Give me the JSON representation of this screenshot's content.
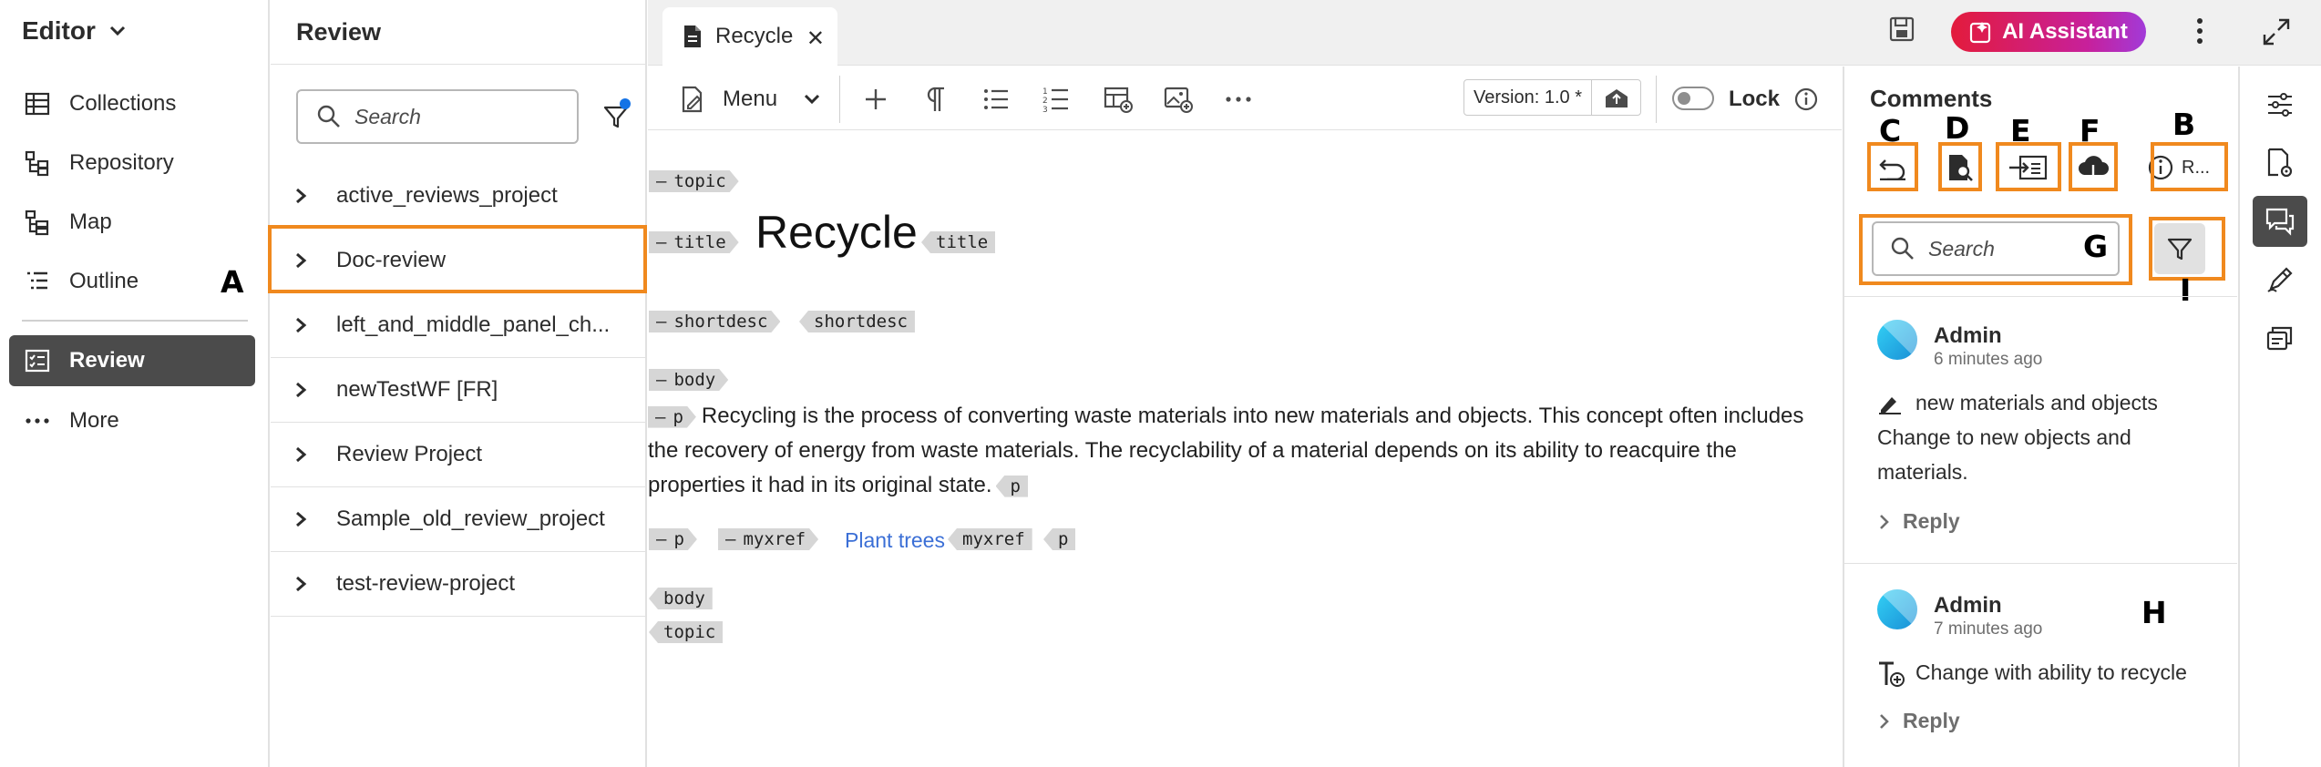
{
  "left_nav": {
    "title": "Editor",
    "items": [
      {
        "label": "Collections",
        "icon": "collections-icon"
      },
      {
        "label": "Repository",
        "icon": "repository-icon"
      },
      {
        "label": "Map",
        "icon": "map-icon"
      },
      {
        "label": "Outline",
        "icon": "outline-icon"
      },
      {
        "label": "Review",
        "icon": "review-icon",
        "active": true
      },
      {
        "label": "More",
        "icon": "more-dots-icon"
      }
    ],
    "callout": "A"
  },
  "review_panel": {
    "title": "Review",
    "search_placeholder": "Search",
    "projects": [
      "active_reviews_project",
      "Doc-review",
      "left_and_middle_panel_ch...",
      "newTestWF [FR]",
      "Review Project",
      "Sample_old_review_project",
      "test-review-project"
    ]
  },
  "tabs": [
    {
      "label": "Recycle",
      "icon": "document-icon"
    }
  ],
  "header": {
    "ai_assistant_label": "AI Assistant"
  },
  "toolbar": {
    "menu_label": "Menu",
    "version_label": "Version: 1.0 *",
    "lock_label": "Lock"
  },
  "document": {
    "tags": {
      "topic": "topic",
      "title": "title",
      "shortdesc": "shortdesc",
      "body": "body",
      "p": "p",
      "myxref": "myxref"
    },
    "title_text": "Recycle",
    "paragraph": "Recycling is the process of converting waste materials into new materials and objects. This concept often includes the recovery of energy from waste materials. The recyclability of a material depends on its ability to reacquire the properties it had in its original state.",
    "link_text": "Plant trees"
  },
  "comments_panel": {
    "title": "Comments",
    "search_placeholder": "Search",
    "info_label": "R...",
    "callouts": {
      "B": "B",
      "C": "C",
      "D": "D",
      "E": "E",
      "F": "F",
      "G": "G",
      "H": "H",
      "I": "I"
    },
    "comments": [
      {
        "user": "Admin",
        "time": "6 minutes ago",
        "icon": "highlight-pen-icon",
        "quote": "new materials and objects",
        "text": "Change to new objects and materials.",
        "reply_label": "Reply"
      },
      {
        "user": "Admin",
        "time": "7 minutes ago",
        "icon": "text-insert-icon",
        "quote": "Change with ability to recycle",
        "text": "",
        "reply_label": "Reply"
      }
    ]
  },
  "colors": {
    "highlight": "#f0891e",
    "active_nav": "#4b4b4b",
    "link": "#3b6fd6",
    "ai_gradient_start": "#e31b3c",
    "ai_gradient_end": "#a23ad8"
  }
}
